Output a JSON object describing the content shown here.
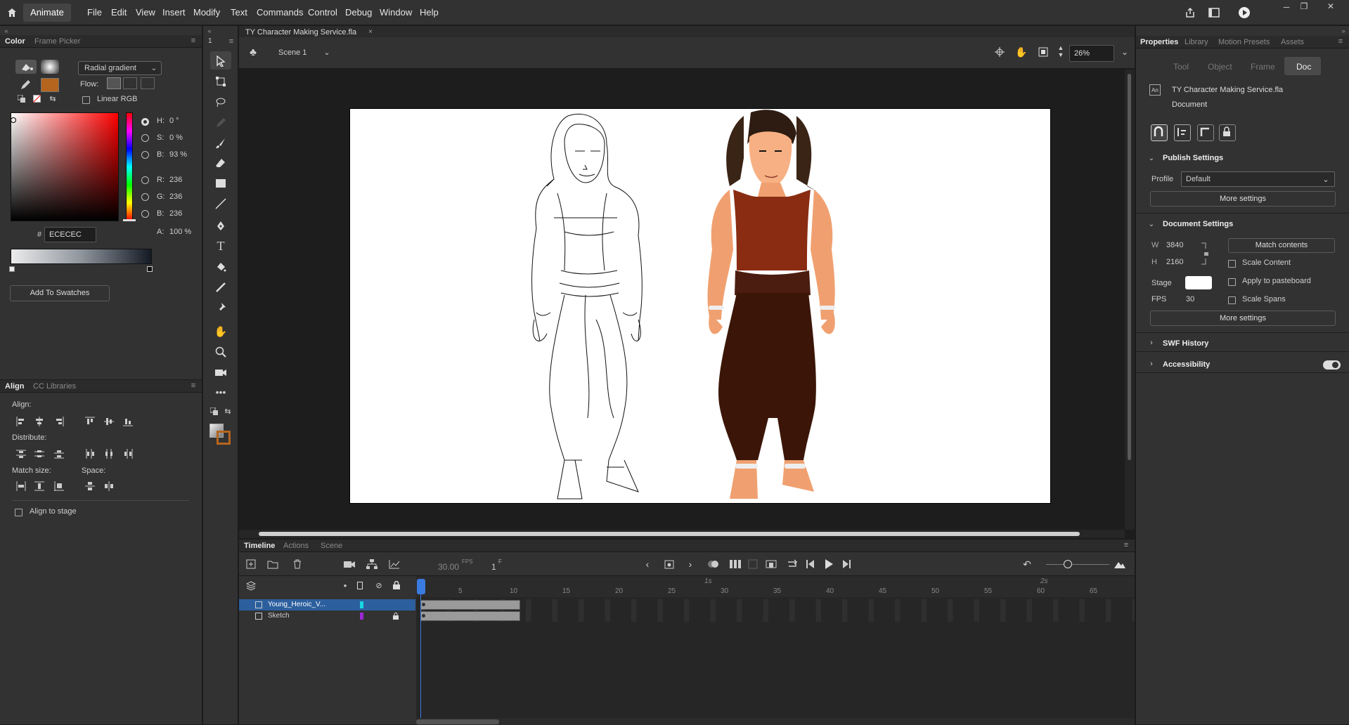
{
  "app": {
    "name": "Animate"
  },
  "menu": [
    "File",
    "Edit",
    "View",
    "Insert",
    "Modify",
    "Text",
    "Commands",
    "Control",
    "Debug",
    "Window",
    "Help"
  ],
  "window_controls": {
    "min": "─",
    "max": "❐",
    "close": "✕"
  },
  "color_panel": {
    "tabs": [
      "Color",
      "Frame Picker"
    ],
    "gradient_type": "Radial gradient",
    "flow_label": "Flow:",
    "linear_rgb": "Linear RGB",
    "h_label": "H:",
    "h_value": "0 °",
    "s_label": "S:",
    "s_value": "0 %",
    "b_label": "B:",
    "b_value": "93 %",
    "r_label": "R:",
    "r_value": "236",
    "g_label": "G:",
    "g_value": "236",
    "b2_label": "B:",
    "b2_value": "236",
    "a_label": "A:",
    "a_value": "100 %",
    "hash": "#",
    "hex_value": "ECECEC",
    "add_swatches": "Add To Swatches",
    "fill_color": "#b5651d"
  },
  "align_panel": {
    "tabs": [
      "Align",
      "CC Libraries"
    ],
    "align": "Align:",
    "distribute": "Distribute:",
    "match_size": "Match size:",
    "space": "Space:",
    "align_to_stage": "Align to stage"
  },
  "toolbar_top": {
    "frame_num": "1"
  },
  "document": {
    "tab_title": "TY Character Making Service.fla",
    "scene": "Scene 1",
    "zoom": "26%"
  },
  "properties": {
    "tabs": [
      "Properties",
      "Library",
      "Motion Presets",
      "Assets"
    ],
    "subtabs": [
      "Tool",
      "Object",
      "Frame",
      "Doc"
    ],
    "doc_name": "TY Character Making Service.fla",
    "doc_type": "Document",
    "publish_settings": "Publish Settings",
    "profile_label": "Profile",
    "profile_value": "Default",
    "more_settings": "More settings",
    "document_settings": "Document Settings",
    "w_label": "W",
    "w_value": "3840",
    "h_label": "H",
    "h_value": "2160",
    "match_contents": "Match contents",
    "scale_content": "Scale Content",
    "stage_label": "Stage",
    "apply_pasteboard": "Apply to pasteboard",
    "fps_label": "FPS",
    "fps_value": "30",
    "scale_spans": "Scale Spans",
    "more_settings2": "More settings",
    "swf_history": "SWF History",
    "accessibility": "Accessibility"
  },
  "timeline": {
    "tabs": [
      "Timeline",
      "Actions",
      "Scene"
    ],
    "fps": "30.00",
    "fps_unit": "FPS",
    "frame": "1",
    "frame_unit": "F",
    "layers": [
      {
        "name": "Young_Heroic_V...",
        "color": "#18d6e0"
      },
      {
        "name": "Sketch",
        "color": "#9b27d6"
      }
    ],
    "ruler": [
      "5",
      "10",
      "15",
      "20",
      "25",
      "30",
      "35",
      "40",
      "45",
      "50",
      "55",
      "60",
      "65"
    ],
    "seconds": [
      "1s",
      "2s"
    ]
  }
}
